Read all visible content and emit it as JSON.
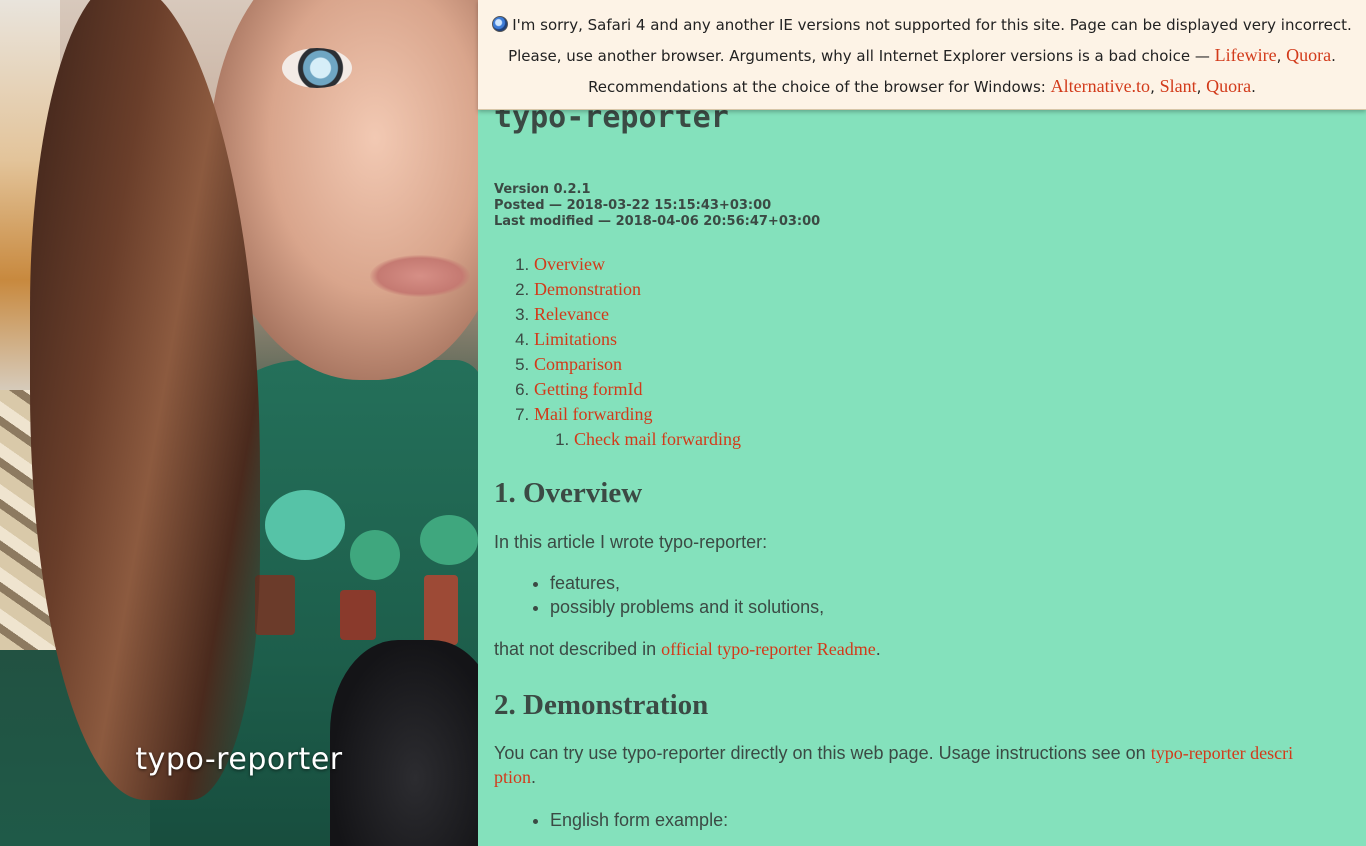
{
  "hero": {
    "title": "typo-reporter"
  },
  "warning": {
    "line1": "I'm sorry, Safari 4 and any another IE versions not supported for this site. Page can be displayed very incorrect.",
    "line2_prefix": "Please, use another browser. Arguments, why all Internet Explorer versions is a bad choice — ",
    "line2_links": [
      "Lifewire",
      "Quora"
    ],
    "line3_prefix": "Recommendations at the choice of the browser for Windows: ",
    "line3_links": [
      "Alternative.to",
      "Slant",
      "Quora"
    ]
  },
  "article": {
    "title": "typo-reporter",
    "version": "Version 0.2.1",
    "posted": "Posted — 2018-03-22 15:15:43+03:00",
    "modified": "Last modified — 2018-04-06 20:56:47+03:00",
    "toc": [
      "Overview",
      "Demonstration",
      "Relevance",
      "Limitations",
      "Comparison",
      "Getting formId",
      "Mail forwarding"
    ],
    "toc_sub": [
      "Check mail forwarding"
    ],
    "section1": {
      "heading": "1. Overview",
      "intro": "In this article I wrote typo-reporter:",
      "bullets": [
        "features,",
        "possibly problems and it solutions,"
      ],
      "outro_prefix": "that not described in ",
      "outro_link": "official typo-reporter Readme"
    },
    "section2": {
      "heading": "2. Demonstration",
      "text_prefix": "You can try use typo-reporter directly on this web page. Usage instructions see on ",
      "text_link_a": "typo-reporter descri",
      "text_link_b": "ption",
      "bullets": [
        "English form example:"
      ]
    }
  },
  "colors": {
    "background": "#84e1bc",
    "link": "#d23a1a",
    "warning_bg": "#fdf3e6",
    "text": "#3b4a44"
  }
}
